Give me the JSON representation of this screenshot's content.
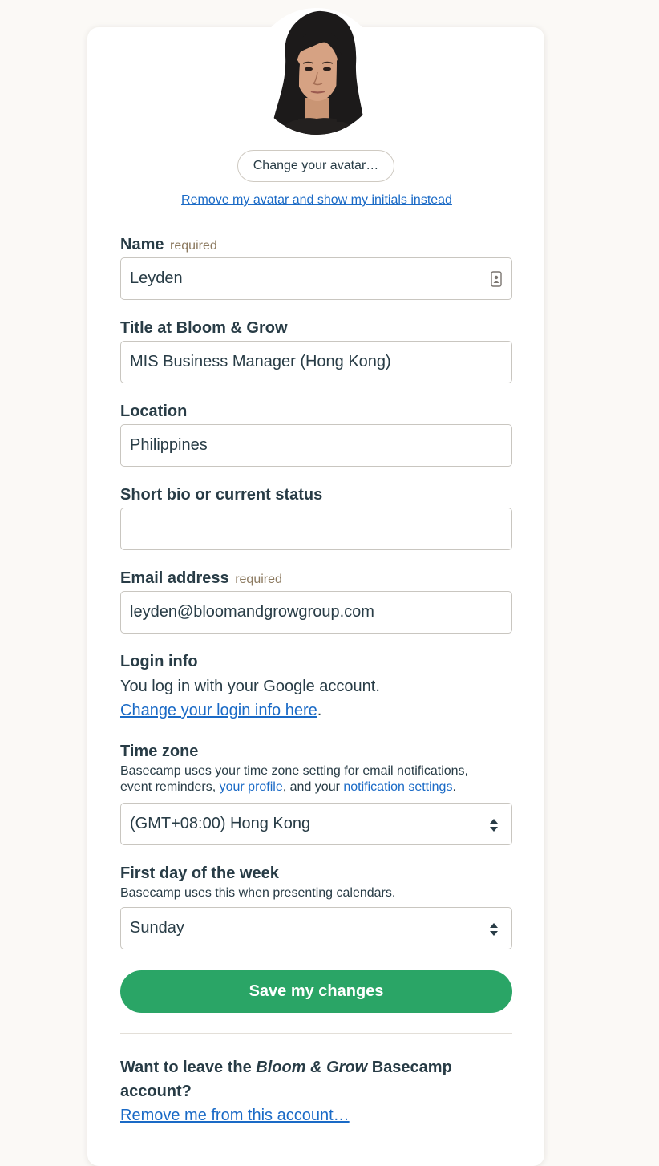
{
  "avatar": {
    "change_label": "Change your avatar…",
    "remove_label": "Remove my avatar and show my initials instead"
  },
  "form": {
    "name": {
      "label": "Name",
      "required": "required",
      "value": "Leyden",
      "icon": "contact-card-icon"
    },
    "title": {
      "label": "Title at Bloom & Grow",
      "value": "MIS Business Manager (Hong Kong)"
    },
    "location": {
      "label": "Location",
      "value": "Philippines"
    },
    "bio": {
      "label": "Short bio or current status",
      "value": ""
    },
    "email": {
      "label": "Email address",
      "required": "required",
      "value": "leyden@bloomandgrowgroup.com"
    },
    "login": {
      "label": "Login info",
      "text": "You log in with your Google account.",
      "link": "Change your login info here",
      "link_suffix": "."
    },
    "timezone": {
      "label": "Time zone",
      "help_line1": "Basecamp uses your time zone setting for email notifications,",
      "help_line2_prefix": "event reminders, ",
      "help_link1": "your profile",
      "help_mid": ", and your ",
      "help_link2": "notification settings",
      "help_suffix": ".",
      "value": "(GMT+08:00) Hong Kong",
      "icon": "select-arrows-icon"
    },
    "week": {
      "label": "First day of the week",
      "help": "Basecamp uses this when presenting calendars.",
      "value": "Sunday",
      "icon": "select-arrows-icon"
    },
    "save_label": "Save my changes"
  },
  "leave": {
    "prefix": "Want to leave the ",
    "account": "Bloom & Grow",
    "suffix": " Basecamp account?",
    "link": "Remove me from this account…"
  },
  "colors": {
    "accent_green": "#2aa566",
    "link_blue": "#1a6ac6",
    "text": "#283c46",
    "required": "#8c7a60"
  }
}
